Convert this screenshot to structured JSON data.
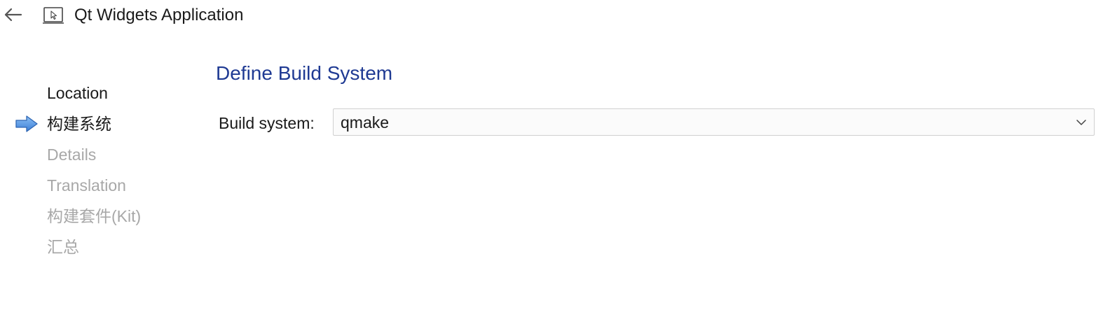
{
  "window": {
    "title": "Qt Widgets Application"
  },
  "icons": {
    "back": "arrow-left-icon",
    "app": "window-cursor-icon",
    "current_step": "arrow-right-icon",
    "dropdown": "chevron-down-icon"
  },
  "steps": [
    {
      "label": "Location",
      "state": "done"
    },
    {
      "label": "构建系统",
      "state": "current"
    },
    {
      "label": "Details",
      "state": "pending"
    },
    {
      "label": "Translation",
      "state": "pending"
    },
    {
      "label": "构建套件(Kit)",
      "state": "pending"
    },
    {
      "label": "汇总",
      "state": "pending"
    }
  ],
  "page": {
    "title": "Define Build System",
    "build_system_label": "Build system:",
    "build_system_value": "qmake"
  },
  "colors": {
    "title_blue": "#1f3a93",
    "arrow_blue": "#4a8fe0",
    "pending_text": "#a8a8a8"
  }
}
